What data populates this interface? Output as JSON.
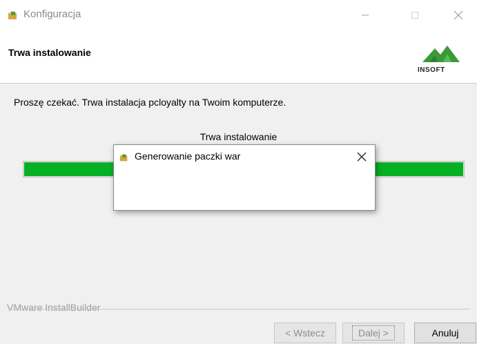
{
  "window": {
    "title": "Konfiguracja",
    "icon": "installer-box-icon",
    "controls": [
      "minimize-icon",
      "maximize-icon",
      "close-icon"
    ]
  },
  "header": {
    "title": "Trwa instalowanie",
    "logo_text": "INSOFT"
  },
  "content": {
    "description": "Proszę czekać. Trwa instalacja pcloyalty na Twoim komputerze.",
    "progress_label": "Trwa instalowanie",
    "progress_fraction": 1.0
  },
  "dialog": {
    "title": "Generowanie paczki war",
    "icon": "installer-box-icon"
  },
  "footer": {
    "builder_label": "VMware InstallBuilder",
    "back_label": "< Wstecz",
    "next_label": "Dalej >",
    "cancel_label": "Anuluj"
  },
  "colors": {
    "progress": "#06b025",
    "logo_green": "#3a9a3a"
  }
}
